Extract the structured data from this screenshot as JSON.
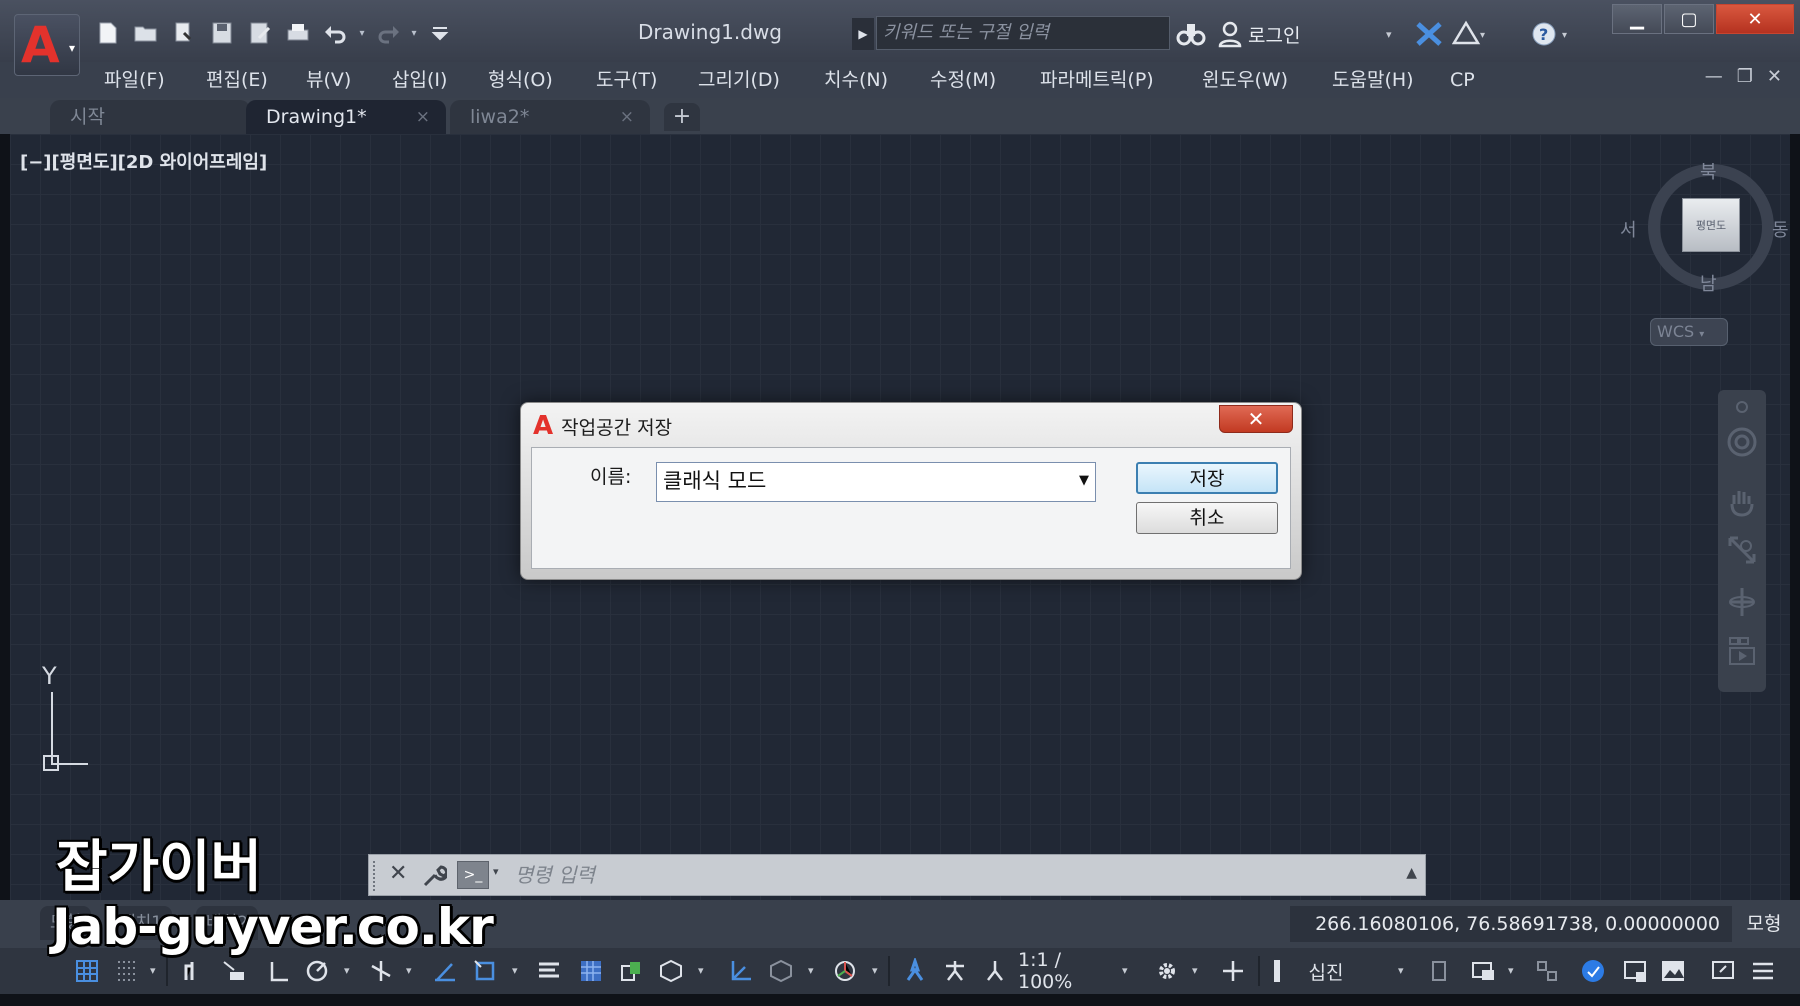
{
  "titlebar": {
    "document_title": "Drawing1.dwg",
    "search_placeholder": "키워드 또는 구절 입력",
    "login_label": "로그인",
    "app_icon": "autocad-a-logo"
  },
  "menu": {
    "items": [
      "파일(F)",
      "편집(E)",
      "뷰(V)",
      "삽입(I)",
      "형식(O)",
      "도구(T)",
      "그리기(D)",
      "치수(N)",
      "수정(M)",
      "파라메트릭(P)",
      "윈도우(W)",
      "도움말(H)",
      "CP"
    ]
  },
  "tabs": [
    {
      "label": "시작"
    },
    {
      "label": "Drawing1*",
      "close": "×"
    },
    {
      "label": "liwa2*",
      "close": "×"
    }
  ],
  "tab_add": "+",
  "viewport": {
    "label": "[−][평면도][2D 와이어프레임]",
    "viewcube": {
      "north": "북",
      "south": "남",
      "east": "동",
      "west": "서",
      "face": "평면도"
    },
    "wcs_label": "WCS",
    "ucs_axis_y": "Y"
  },
  "dialog": {
    "title": "작업공간 저장",
    "name_label": "이름:",
    "name_value": "클래식 모드",
    "save_button": "저장",
    "cancel_button": "취소",
    "close": "✕"
  },
  "command_line": {
    "placeholder": "명령 입력"
  },
  "layout_tabs": [
    "모형",
    "배치1",
    "배치2"
  ],
  "status": {
    "coordinates": "266.16080106, 76.58691738, 0.00000000",
    "model_label": "모형",
    "scale": "1:1 / 100%",
    "units": "십진"
  },
  "watermark": {
    "line1": "잡가이버",
    "line2": "Jab-guyver.co.kr"
  },
  "colors": {
    "brand_red": "#e3322c",
    "canvas": "#212835",
    "accent_blue": "#3c7fb1"
  }
}
